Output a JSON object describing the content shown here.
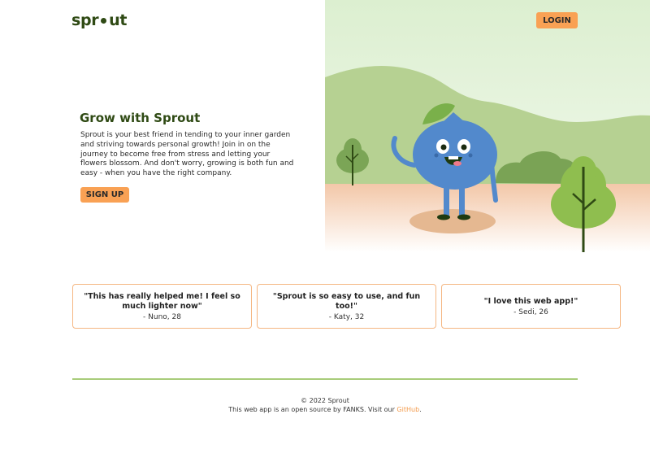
{
  "brand": {
    "name_prefix": "spr",
    "name_o": "o",
    "name_suffix": "ut"
  },
  "nav": {
    "login_label": "LOGIN"
  },
  "hero": {
    "title": "Grow with Sprout",
    "description": "Sprout is your best friend in tending to your inner garden and striving towards personal growth! Join in on the journey to become free from stress and letting your flowers blossom. And don't worry, growing is both fun and easy - when you have the right company.",
    "signup_label": "SIGN UP"
  },
  "testimonials": [
    {
      "quote": "\"This has really helped me! I feel so much lighter now\"",
      "author": "- Nuno, 28"
    },
    {
      "quote": "\"Sprout is so easy to use, and fun too!\"",
      "author": "- Katy, 32"
    },
    {
      "quote": "\"I love this web app!\"",
      "author": "- Sedi, 26"
    }
  ],
  "footer": {
    "copyright": "© 2022 Sprout",
    "open_source_text": "This web app is an open source by FANKS. Visit our ",
    "github_label": "GitHub",
    "after_link": "."
  },
  "icons": [
    "sprout-logo-seed-icon",
    "blueberry-mascot-icon",
    "tree-icon"
  ],
  "colors": {
    "accent": "#f9a154",
    "brand_green": "#2f4a14",
    "card_border": "#f5b783",
    "divider": "#a8cc7a",
    "mascot_blue": "#5289cc"
  }
}
